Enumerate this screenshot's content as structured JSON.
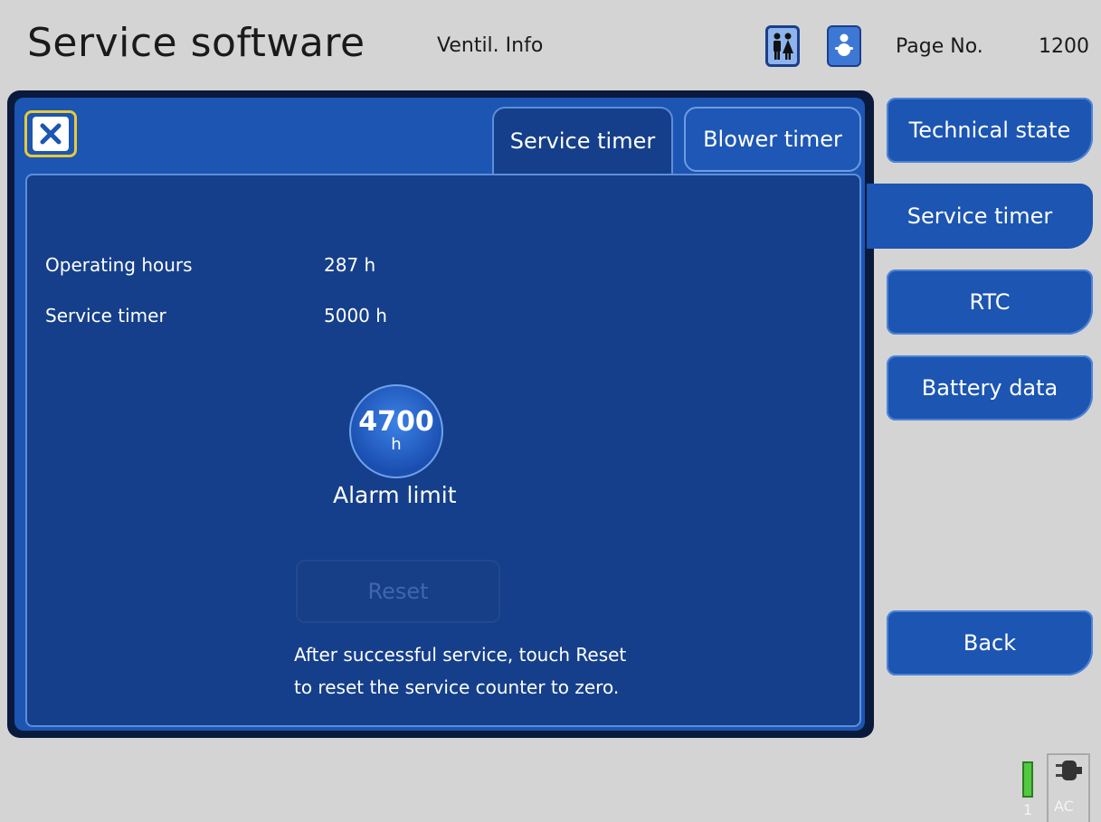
{
  "header": {
    "title": "Service software",
    "subtitle": "Ventil. Info",
    "page_label": "Page No.",
    "page_number": "1200",
    "mode_icons": [
      "adult-patient-icon",
      "child-patient-icon"
    ]
  },
  "dialog": {
    "close_icon": "close-icon",
    "tabs": [
      {
        "label": "Service timer",
        "active": true
      },
      {
        "label": "Blower timer",
        "active": false
      }
    ],
    "rows": [
      {
        "label": "Operating hours",
        "value": "287  h"
      },
      {
        "label": "Service timer",
        "value": "5000  h"
      }
    ],
    "alarm": {
      "value": "4700",
      "unit": "h",
      "label": "Alarm limit"
    },
    "reset_label": "Reset",
    "reset_note_line1": "After successful service, touch Reset",
    "reset_note_line2": "to reset the service counter to zero."
  },
  "sidebar": {
    "items": [
      {
        "label": "Technical state",
        "active": false
      },
      {
        "label": "Service timer",
        "active": true
      },
      {
        "label": "RTC",
        "active": false
      },
      {
        "label": "Battery data",
        "active": false
      }
    ],
    "back_label": "Back"
  },
  "status": {
    "battery_label": "1",
    "ac_label": "AC",
    "battery_color": "#53c842"
  }
}
